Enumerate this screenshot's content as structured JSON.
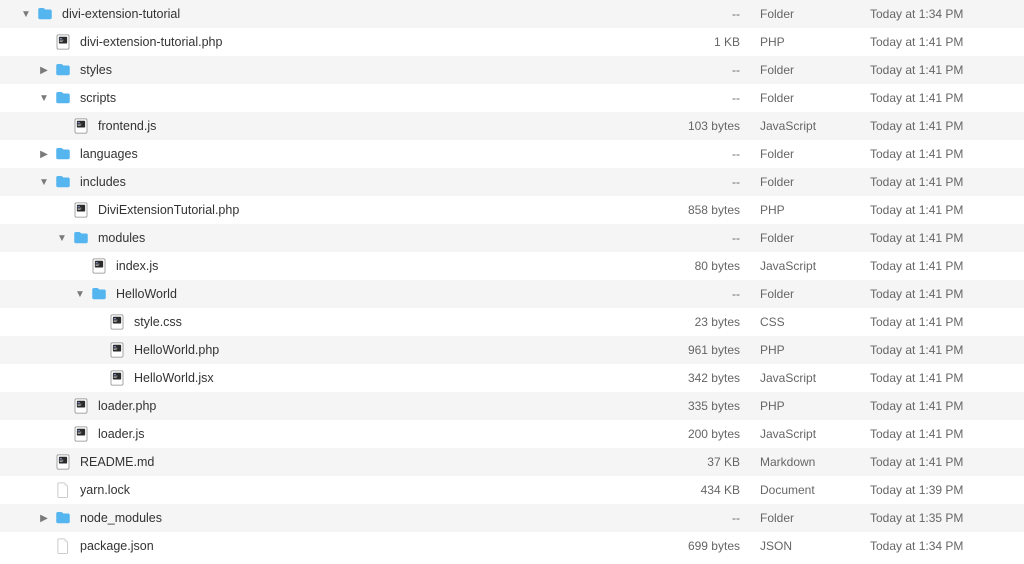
{
  "rows": [
    {
      "indent": 0,
      "disclosure": "down",
      "icon": "folder",
      "name": "divi-extension-tutorial",
      "size": "--",
      "kind": "Folder",
      "date": "Today at 1:34 PM"
    },
    {
      "indent": 1,
      "disclosure": "none",
      "icon": "code",
      "name": "divi-extension-tutorial.php",
      "size": "1 KB",
      "kind": "PHP",
      "date": "Today at 1:41 PM"
    },
    {
      "indent": 1,
      "disclosure": "right",
      "icon": "folder",
      "name": "styles",
      "size": "--",
      "kind": "Folder",
      "date": "Today at 1:41 PM"
    },
    {
      "indent": 1,
      "disclosure": "down",
      "icon": "folder",
      "name": "scripts",
      "size": "--",
      "kind": "Folder",
      "date": "Today at 1:41 PM"
    },
    {
      "indent": 2,
      "disclosure": "none",
      "icon": "code",
      "name": "frontend.js",
      "size": "103 bytes",
      "kind": "JavaScript",
      "date": "Today at 1:41 PM"
    },
    {
      "indent": 1,
      "disclosure": "right",
      "icon": "folder",
      "name": "languages",
      "size": "--",
      "kind": "Folder",
      "date": "Today at 1:41 PM"
    },
    {
      "indent": 1,
      "disclosure": "down",
      "icon": "folder",
      "name": "includes",
      "size": "--",
      "kind": "Folder",
      "date": "Today at 1:41 PM"
    },
    {
      "indent": 2,
      "disclosure": "none",
      "icon": "code",
      "name": "DiviExtensionTutorial.php",
      "size": "858 bytes",
      "kind": "PHP",
      "date": "Today at 1:41 PM"
    },
    {
      "indent": 2,
      "disclosure": "down",
      "icon": "folder",
      "name": "modules",
      "size": "--",
      "kind": "Folder",
      "date": "Today at 1:41 PM"
    },
    {
      "indent": 3,
      "disclosure": "none",
      "icon": "code",
      "name": "index.js",
      "size": "80 bytes",
      "kind": "JavaScript",
      "date": "Today at 1:41 PM"
    },
    {
      "indent": 3,
      "disclosure": "down",
      "icon": "folder",
      "name": "HelloWorld",
      "size": "--",
      "kind": "Folder",
      "date": "Today at 1:41 PM"
    },
    {
      "indent": 4,
      "disclosure": "none",
      "icon": "code",
      "name": "style.css",
      "size": "23 bytes",
      "kind": "CSS",
      "date": "Today at 1:41 PM"
    },
    {
      "indent": 4,
      "disclosure": "none",
      "icon": "code",
      "name": "HelloWorld.php",
      "size": "961 bytes",
      "kind": "PHP",
      "date": "Today at 1:41 PM"
    },
    {
      "indent": 4,
      "disclosure": "none",
      "icon": "code",
      "name": "HelloWorld.jsx",
      "size": "342 bytes",
      "kind": "JavaScript",
      "date": "Today at 1:41 PM"
    },
    {
      "indent": 2,
      "disclosure": "none",
      "icon": "code",
      "name": "loader.php",
      "size": "335 bytes",
      "kind": "PHP",
      "date": "Today at 1:41 PM"
    },
    {
      "indent": 2,
      "disclosure": "none",
      "icon": "code",
      "name": "loader.js",
      "size": "200 bytes",
      "kind": "JavaScript",
      "date": "Today at 1:41 PM"
    },
    {
      "indent": 1,
      "disclosure": "none",
      "icon": "code",
      "name": "README.md",
      "size": "37 KB",
      "kind": "Markdown",
      "date": "Today at 1:41 PM"
    },
    {
      "indent": 1,
      "disclosure": "none",
      "icon": "blank",
      "name": "yarn.lock",
      "size": "434 KB",
      "kind": "Document",
      "date": "Today at 1:39 PM"
    },
    {
      "indent": 1,
      "disclosure": "right",
      "icon": "folder",
      "name": "node_modules",
      "size": "--",
      "kind": "Folder",
      "date": "Today at 1:35 PM"
    },
    {
      "indent": 1,
      "disclosure": "none",
      "icon": "blank",
      "name": "package.json",
      "size": "699 bytes",
      "kind": "JSON",
      "date": "Today at 1:34 PM"
    }
  ],
  "baseIndentPx": 20,
  "indentStepPx": 18
}
